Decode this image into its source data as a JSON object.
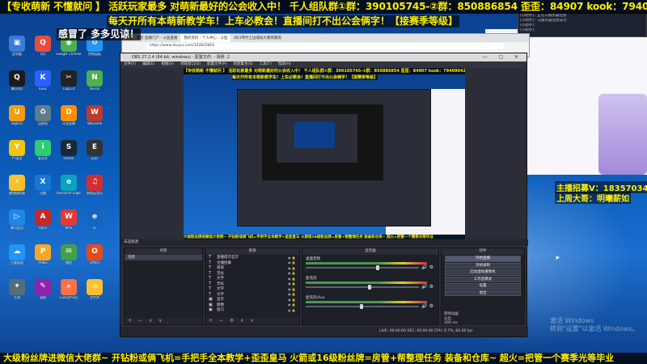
{
  "banner": {
    "line1": "【专收萌新 不懂就问 】 活跃玩家最多 对萌新最好的公会收入中！ 千人组队群①群：390105745-②群：850886854 歪歪：84907 kook：79409042",
    "line2": "每天开所有本萌新教学车！上车必教会！直播间打不出公会俩字！【接赛季等级】",
    "line3": "感冒了 多多见谅！"
  },
  "marquee": "大级粉丝牌进微信大佬群~ 开钻粉或俩飞机=手把手全本教学+歪歪皇马 火箭或16级粉丝牌=房管+帮整理任务 装备和仓库~ 超火=把管一个赛季光等毕业",
  "right_overlay": {
    "recruit": "主播招募V：1835703459",
    "big_brother": "上周大哥：明曦薪如",
    "watermark_line1": "激活 Windows",
    "watermark_line2": "转到\"设置\"以激活 Windows。"
  },
  "chat_window": {
    "rows": [
      "[小助手]：正在与服务器连接",
      "[小助手]：与服务器连接成功",
      "(小助手)：",
      "[小助手]："
    ]
  },
  "browser": {
    "tabs": [
      "斗鱼 - 聚焦 直播门户 - 斗鱼直播",
      "我的资料 - 个人中心 - 斗鱼",
      "四川绵竹土边缝斑大暴雨暴雨"
    ],
    "address": "https://www.douyu.com/102825802"
  },
  "obs": {
    "title": "OBS 27.2.4 (64-bit, windows) - 配置文件: - 场景: 2",
    "menus": [
      "文件(F)",
      "编辑(E)",
      "视图(V)",
      "停靠窗口(D)",
      "配置文件(P)",
      "场景集合(S)",
      "工具(T)",
      "帮助(H)"
    ],
    "dock_header_left": "未选择源",
    "docks": {
      "scenes_title": "场景",
      "sources_title": "来源",
      "mixer_title": "混音器",
      "controls_title": "控件",
      "scenes": [
        "场景"
      ],
      "sources": [
        {
          "type": "T",
          "name": "直播提示显示"
        },
        {
          "type": "T",
          "name": "主播招募"
        },
        {
          "type": "T",
          "name": "感冒"
        },
        {
          "type": "T",
          "name": "无标"
        },
        {
          "type": "T",
          "name": "文字"
        },
        {
          "type": "T",
          "name": "无标"
        },
        {
          "type": "T",
          "name": "文字"
        },
        {
          "type": "T",
          "name": "文字"
        },
        {
          "type": "▣",
          "name": "显示"
        },
        {
          "type": "▣",
          "name": "图像"
        },
        {
          "type": "▣",
          "name": "窗口"
        }
      ],
      "mixer": [
        {
          "name": "桌面音频",
          "level": 0.62
        },
        {
          "name": "麦克风",
          "level": 0.55
        },
        {
          "name": "麦克风/Aux",
          "level": 0.48
        }
      ],
      "controls": [
        "开始直播",
        "开始录制",
        "启动虚拟摄像机",
        "工作室模式",
        "设置",
        "退出"
      ]
    },
    "transition_label": "转场动画",
    "transition_value": "淡出",
    "transition_duration": "300 ms",
    "status": "LIVE: 00:00:00  REC: 00:00:00  CPU: 6.7%, 60.00 fps"
  },
  "desktop_icons": [
    {
      "name": "此电脑",
      "color": "#3a7bd5",
      "glyph": "▣"
    },
    {
      "name": "QQ",
      "color": "#e74c3c",
      "glyph": "Q"
    },
    {
      "name": "Google Chrome",
      "color": "#4caf50",
      "glyph": "◉"
    },
    {
      "name": "控制面板",
      "color": "#2196f3",
      "glyph": "⚙"
    },
    {
      "name": "腾讯QQ",
      "color": "#1b1b1b",
      "glyph": "Q"
    },
    {
      "name": "Kook",
      "color": "#2962ff",
      "glyph": "K"
    },
    {
      "name": "CapCut",
      "color": "#222",
      "glyph": "✂"
    },
    {
      "name": "Nvidia",
      "color": "#4caf50",
      "glyph": "N"
    },
    {
      "name": "网易UU",
      "color": "#f39c12",
      "glyph": "U"
    },
    {
      "name": "回收站",
      "color": "#607d8b",
      "glyph": "♻"
    },
    {
      "name": "斗鱼直播",
      "color": "#ff8f00",
      "glyph": "D"
    },
    {
      "name": "WeGame",
      "color": "#c0392b",
      "glyph": "W"
    },
    {
      "name": "YY语音",
      "color": "#f1c40f",
      "glyph": "Y"
    },
    {
      "name": "爱奇艺",
      "color": "#2ecc71",
      "glyph": "i"
    },
    {
      "name": "Steam",
      "color": "#1b2838",
      "glyph": "S"
    },
    {
      "name": "Epic",
      "color": "#333",
      "glyph": "E"
    },
    {
      "name": "雷电模拟器",
      "color": "#fbc02d",
      "glyph": "⚡"
    },
    {
      "name": "迅雷",
      "color": "#1976d2",
      "glyph": "X"
    },
    {
      "name": "Microsoft Edge",
      "color": "#0aa2c0",
      "glyph": "e"
    },
    {
      "name": "网易云音乐",
      "color": "#d32f2f",
      "glyph": "♫"
    },
    {
      "name": "腾讯会议",
      "color": "#1e88e5",
      "glyph": "▷"
    },
    {
      "name": "Apex",
      "color": "#c62828",
      "glyph": "A"
    },
    {
      "name": "WPS",
      "color": "#e53935",
      "glyph": "W"
    },
    {
      "name": "IE",
      "color": "#1565c0",
      "glyph": "e"
    },
    {
      "name": "百度网盘",
      "color": "#2196f3",
      "glyph": "☁"
    },
    {
      "name": "PUBG",
      "color": "#f9a825",
      "glyph": "P"
    },
    {
      "name": "微信",
      "color": "#43a047",
      "glyph": "✉"
    },
    {
      "name": "Office",
      "color": "#e64a19",
      "glyph": "O"
    },
    {
      "name": "工具",
      "color": "#546e7a",
      "glyph": "✦"
    },
    {
      "name": "画图",
      "color": "#8e24aa",
      "glyph": "✎"
    },
    {
      "name": "Everything",
      "color": "#ff7043",
      "glyph": "⌕"
    },
    {
      "name": "文件夹",
      "color": "#fbc02d",
      "glyph": "▭"
    }
  ]
}
